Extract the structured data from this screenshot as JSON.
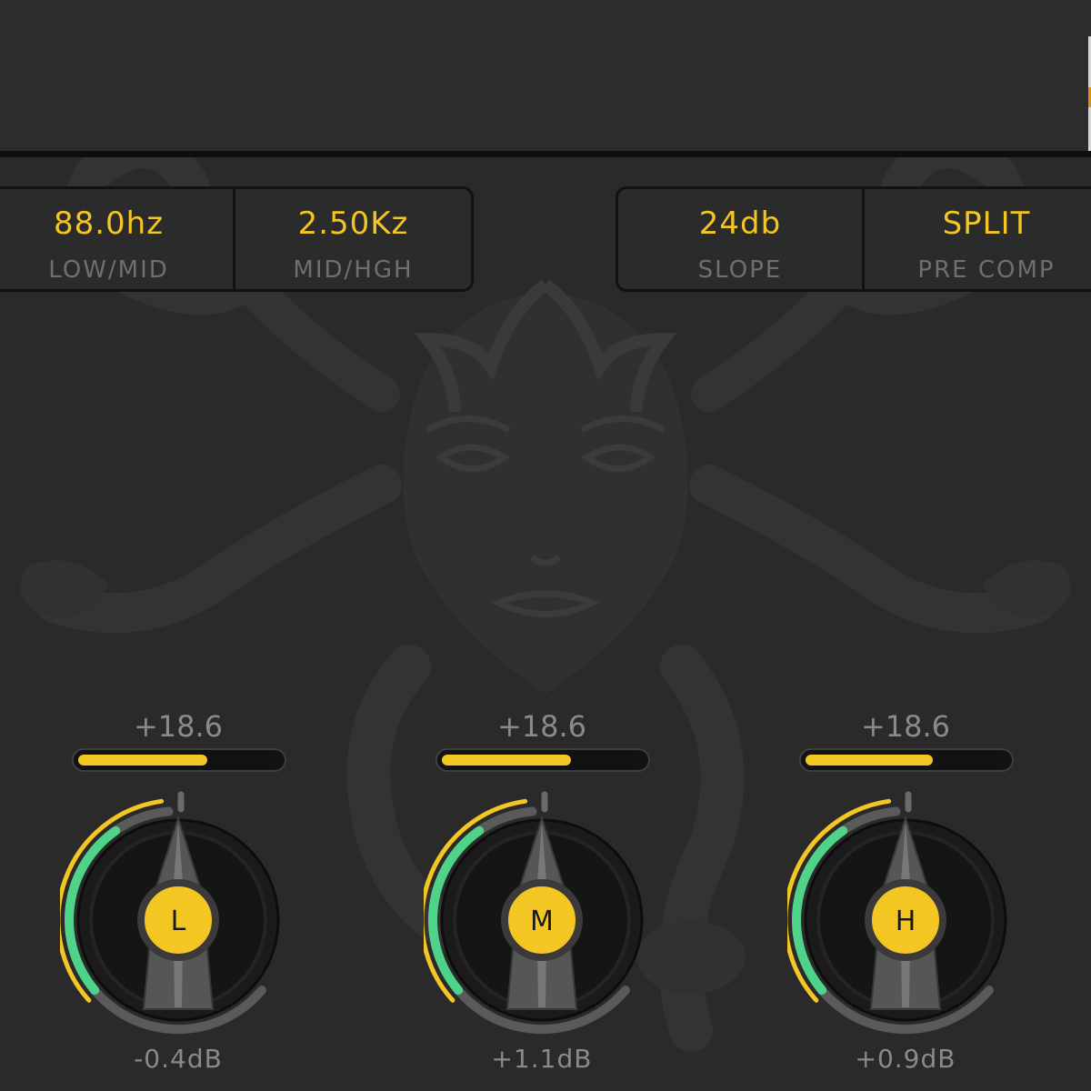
{
  "crossover": {
    "low_mid": {
      "value": "88.0hz",
      "label": "LOW/MID"
    },
    "mid_high": {
      "value": "2.50Kz",
      "label": "MID/HGH"
    }
  },
  "options": {
    "slope": {
      "value": "24db",
      "label": "SLOPE"
    },
    "mode": {
      "value": "SPLIT",
      "label": "PRE COMP"
    }
  },
  "bands": [
    {
      "letter": "L",
      "peak": "+18.6",
      "gain": "-0.4dB",
      "meter_level": 0.64
    },
    {
      "letter": "M",
      "peak": "+18.6",
      "gain": "+1.1dB",
      "meter_level": 0.64
    },
    {
      "letter": "H",
      "peak": "+18.6",
      "gain": "+0.9dB",
      "meter_level": 0.63
    }
  ],
  "colors": {
    "accent": "#f3c623",
    "green": "#4fd38a",
    "label_grey": "#6f6f6f",
    "background": "#2a2a2a"
  }
}
